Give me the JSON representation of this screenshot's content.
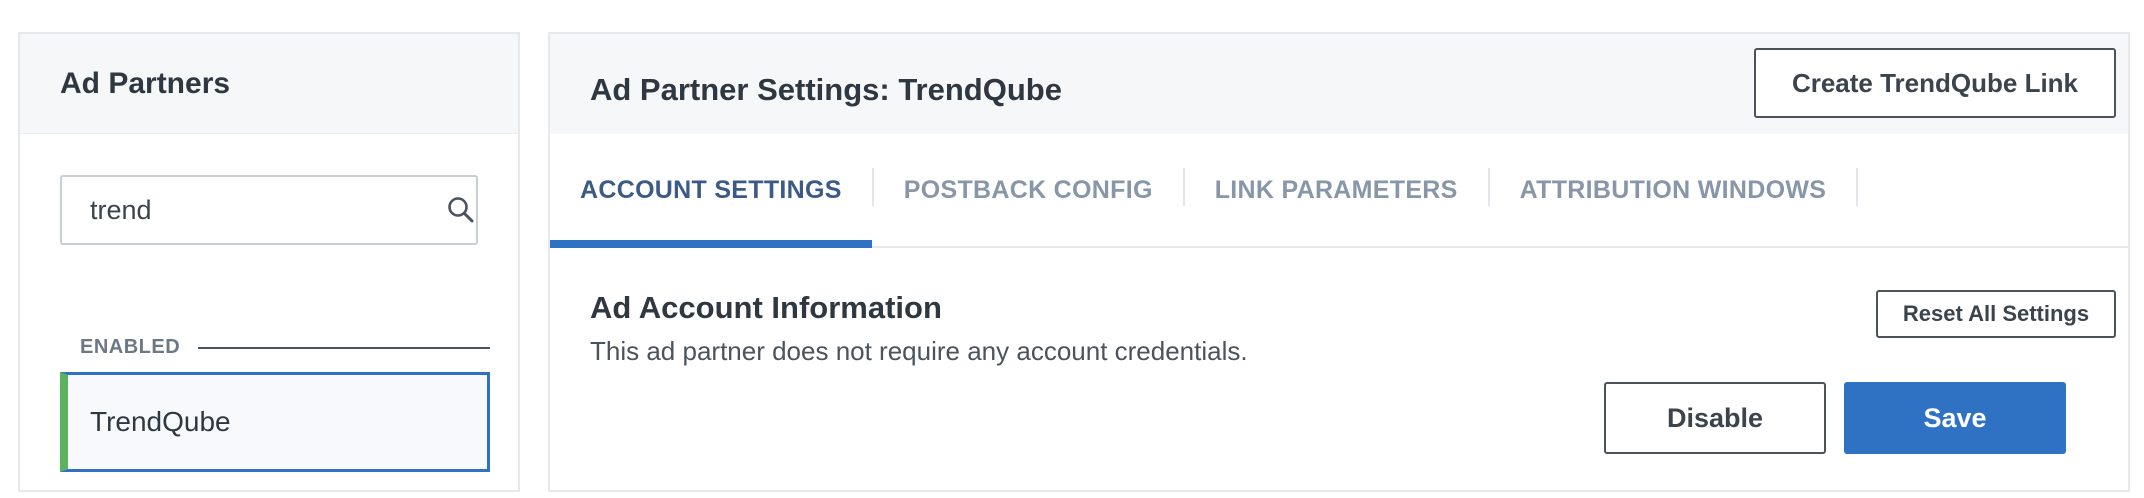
{
  "sidebar": {
    "title": "Ad Partners",
    "search": {
      "value": "trend",
      "icon": "search-icon"
    },
    "section_label": "ENABLED",
    "items": [
      {
        "label": "TrendQube",
        "status_color": "#5bb35e"
      }
    ]
  },
  "main": {
    "title": "Ad Partner Settings: TrendQube",
    "create_link_label": "Create TrendQube Link",
    "tabs": [
      {
        "label": "ACCOUNT SETTINGS",
        "active": true
      },
      {
        "label": "POSTBACK CONFIG",
        "active": false
      },
      {
        "label": "LINK PARAMETERS",
        "active": false
      },
      {
        "label": "ATTRIBUTION WINDOWS",
        "active": false
      }
    ],
    "section": {
      "title": "Ad Account Information",
      "description": "This ad partner does not require any account credentials.",
      "reset_label": "Reset All Settings"
    },
    "actions": {
      "disable_label": "Disable",
      "save_label": "Save"
    }
  },
  "colors": {
    "accent": "#2f72c4",
    "enabled_indicator": "#5bb35e"
  }
}
